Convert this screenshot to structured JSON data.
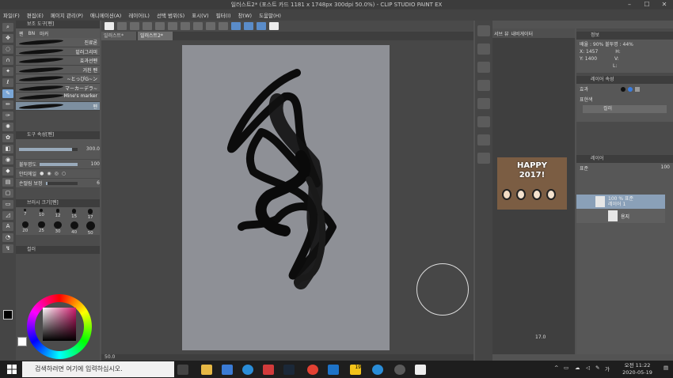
{
  "window": {
    "title": "일러스트2* (포스트 카드 1181 x 1748px 300dpi 50.0%) - CLIP STUDIO PAINT EX",
    "minimize": "–",
    "maximize": "☐",
    "close": "✕"
  },
  "menu": [
    "파일(F)",
    "편집(E)",
    "페이지 관리(P)",
    "애니메이션(A)",
    "레이어(L)",
    "선택 범위(S)",
    "표시(V)",
    "필터(I)",
    "창(W)",
    "도움말(H)"
  ],
  "doc_tabs": [
    "일러스트*",
    "일러스트2*"
  ],
  "left_panel": {
    "subtool_header": "보조 도구[펜]",
    "subtool_tabs": [
      "펜",
      "BN",
      "마커"
    ],
    "brushes": [
      "진료론",
      "밑러그리미",
      "효과선펜",
      "거친 펜",
      "~とっぴG~ン",
      "マーカーデラ~",
      "Mine's marker",
      "펜"
    ],
    "tool_prop_header": "도구 속성[펜]",
    "brush_size_value": "300.0",
    "opacity_label": "불투명도",
    "opacity_value": "100",
    "antialias_label": "안티에일",
    "stabilization_label": "손떨림 보정",
    "stabilization_value": "6",
    "brush_size_panel_header": "브러시 크기[펜]",
    "sizes": [
      "7",
      "10",
      "12",
      "15",
      "17",
      "20",
      "25",
      "30",
      "40",
      "50"
    ],
    "color_header": "컬러",
    "opacity_fraction": 1.0,
    "stabilization_fraction": 0.06
  },
  "canvas": {
    "zoom": "50.0"
  },
  "navigator": {
    "tabs": [
      "서브 뷰",
      "내비게이터"
    ],
    "thumb_text_1": "HAPPY",
    "thumb_text_2": "2017!",
    "zoom": "17.0"
  },
  "info_panel": {
    "header": "정보",
    "scale": "배율 : 90%",
    "opacity": "불투명 : 44%",
    "x": "X: 1457",
    "y": "Y: 1400",
    "h": "H:",
    "v": "V:",
    "l": "L:"
  },
  "layer_props": {
    "header": "레이어 속성",
    "effect_label": "효과",
    "display_label": "표현색",
    "display_value": "컬러"
  },
  "layers_panel": {
    "header": "레이어",
    "blend": "표준",
    "opacity": "100",
    "layers": [
      {
        "line1": "100 % 표준",
        "line2": "레이어 1"
      },
      {
        "line1": "",
        "line2": "용지"
      }
    ]
  },
  "taskbar": {
    "search_placeholder": "검색하려면 여기에 입력하십시오.",
    "badge": "19",
    "time": "오전 11:22",
    "date": "2020-05-19",
    "ime": "가"
  },
  "colors": {
    "accent": "#7aa6d6",
    "paper": "#8e9096"
  }
}
